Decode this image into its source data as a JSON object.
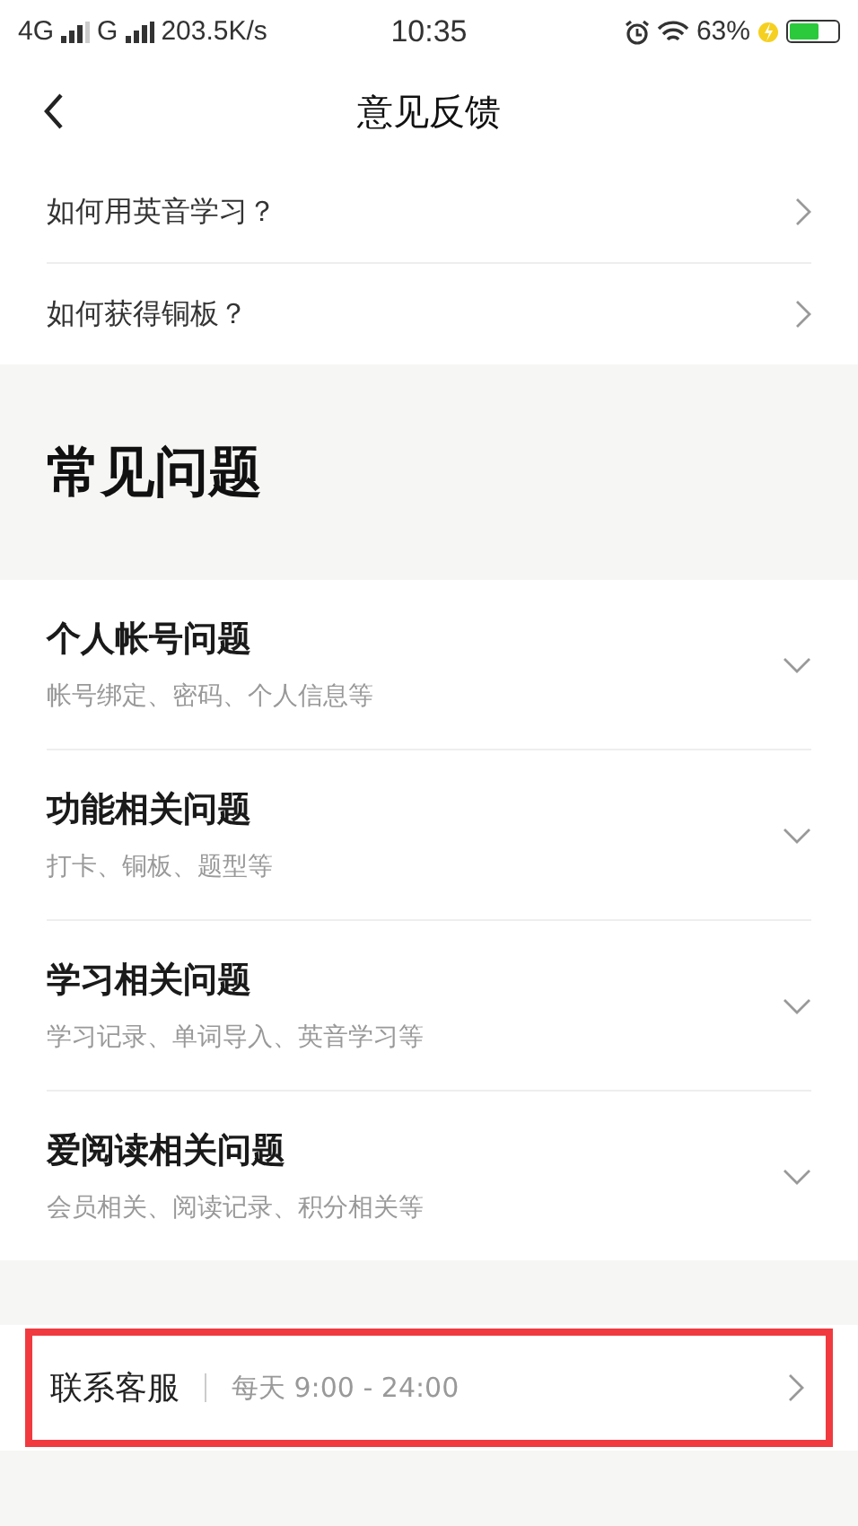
{
  "status_bar": {
    "carrier_1": "4G",
    "carrier_2": "G",
    "speed": "203.5K/s",
    "time": "10:35",
    "battery": "63%",
    "charging": true
  },
  "nav": {
    "title": "意见反馈"
  },
  "quick_links": [
    {
      "label": "如何用英音学习？"
    },
    {
      "label": "如何获得铜板？"
    }
  ],
  "faq": {
    "heading": "常见问题",
    "items": [
      {
        "title": "个人帐号问题",
        "subtitle": "帐号绑定、密码、个人信息等",
        "expanded": false
      },
      {
        "title": "功能相关问题",
        "subtitle": "打卡、铜板、题型等",
        "expanded": false
      },
      {
        "title": "学习相关问题",
        "subtitle": "学习记录、单词导入、英音学习等",
        "expanded": false
      },
      {
        "title": "爱阅读相关问题",
        "subtitle": "会员相关、阅读记录、积分相关等",
        "expanded": false
      }
    ]
  },
  "contact": {
    "label": "联系客服",
    "hours": "每天 9:00 - 24:00",
    "highlighted": true
  }
}
